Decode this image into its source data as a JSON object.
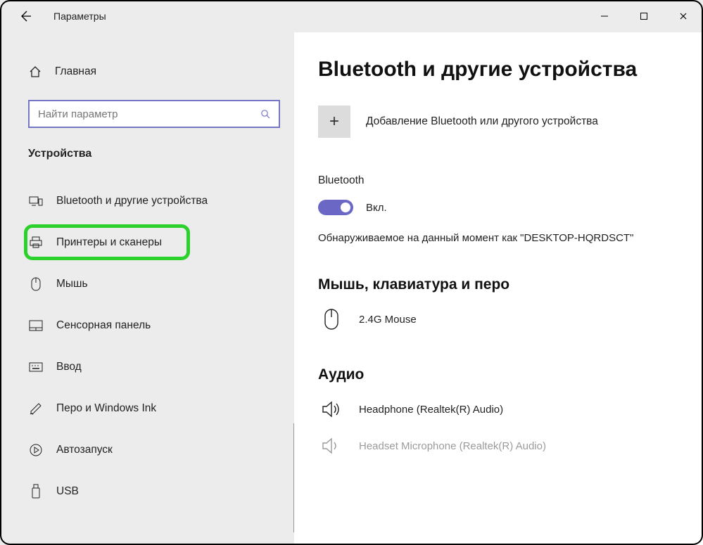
{
  "titlebar": {
    "app_title": "Параметры"
  },
  "sidebar": {
    "home_label": "Главная",
    "search_placeholder": "Найти параметр",
    "category": "Устройства",
    "items": [
      {
        "label": "Bluetooth и другие устройства"
      },
      {
        "label": "Принтеры и сканеры"
      },
      {
        "label": "Мышь"
      },
      {
        "label": "Сенсорная панель"
      },
      {
        "label": "Ввод"
      },
      {
        "label": "Перо и Windows Ink"
      },
      {
        "label": "Автозапуск"
      },
      {
        "label": "USB"
      }
    ]
  },
  "main": {
    "title": "Bluetooth и другие устройства",
    "add_label": "Добавление Bluetooth или другого устройства",
    "bt_section": "Bluetooth",
    "toggle_state": "Вкл.",
    "discoverable_text": "Обнаруживаемое на данный момент как \"DESKTOP-HQRDSCT\"",
    "mouse_section": "Мышь, клавиатура и перо",
    "mouse_device": "2.4G Mouse",
    "audio_section": "Аудио",
    "audio_device1": "Headphone (Realtek(R) Audio)",
    "audio_device2": "Headset Microphone (Realtek(R) Audio)"
  }
}
